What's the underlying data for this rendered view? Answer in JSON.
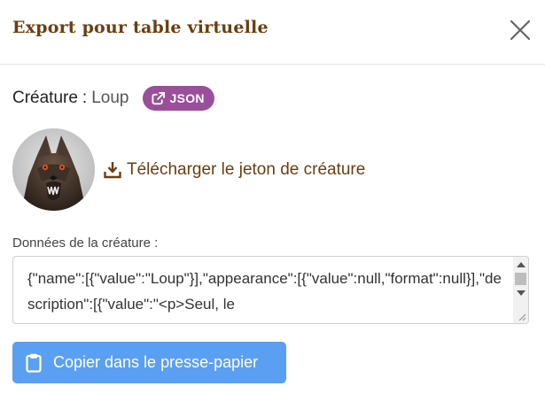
{
  "modal": {
    "title": "Export pour table virtuelle",
    "close_icon": "close-icon"
  },
  "creature": {
    "label": "Créature",
    "separator": ":",
    "name": "Loup",
    "json_badge": "JSON",
    "json_icon": "external-link-icon",
    "avatar_icon": "wolf-portrait"
  },
  "download": {
    "label": "Télécharger le jeton de créature",
    "icon": "download-icon"
  },
  "data_field": {
    "label": "Données de la créature :",
    "value": "{\"name\":[{\"value\":\"Loup\"}],\"appearance\":[{\"value\":null,\"format\":null}],\"description\":[{\"value\":\"<p>Seul, le"
  },
  "copy_button": {
    "label": "Copier dans le presse-papier",
    "icon": "clipboard-icon"
  },
  "colors": {
    "title_brown": "#6b3e0f",
    "badge_purple": "#9a4f9b",
    "button_blue": "#5b9ff2"
  }
}
